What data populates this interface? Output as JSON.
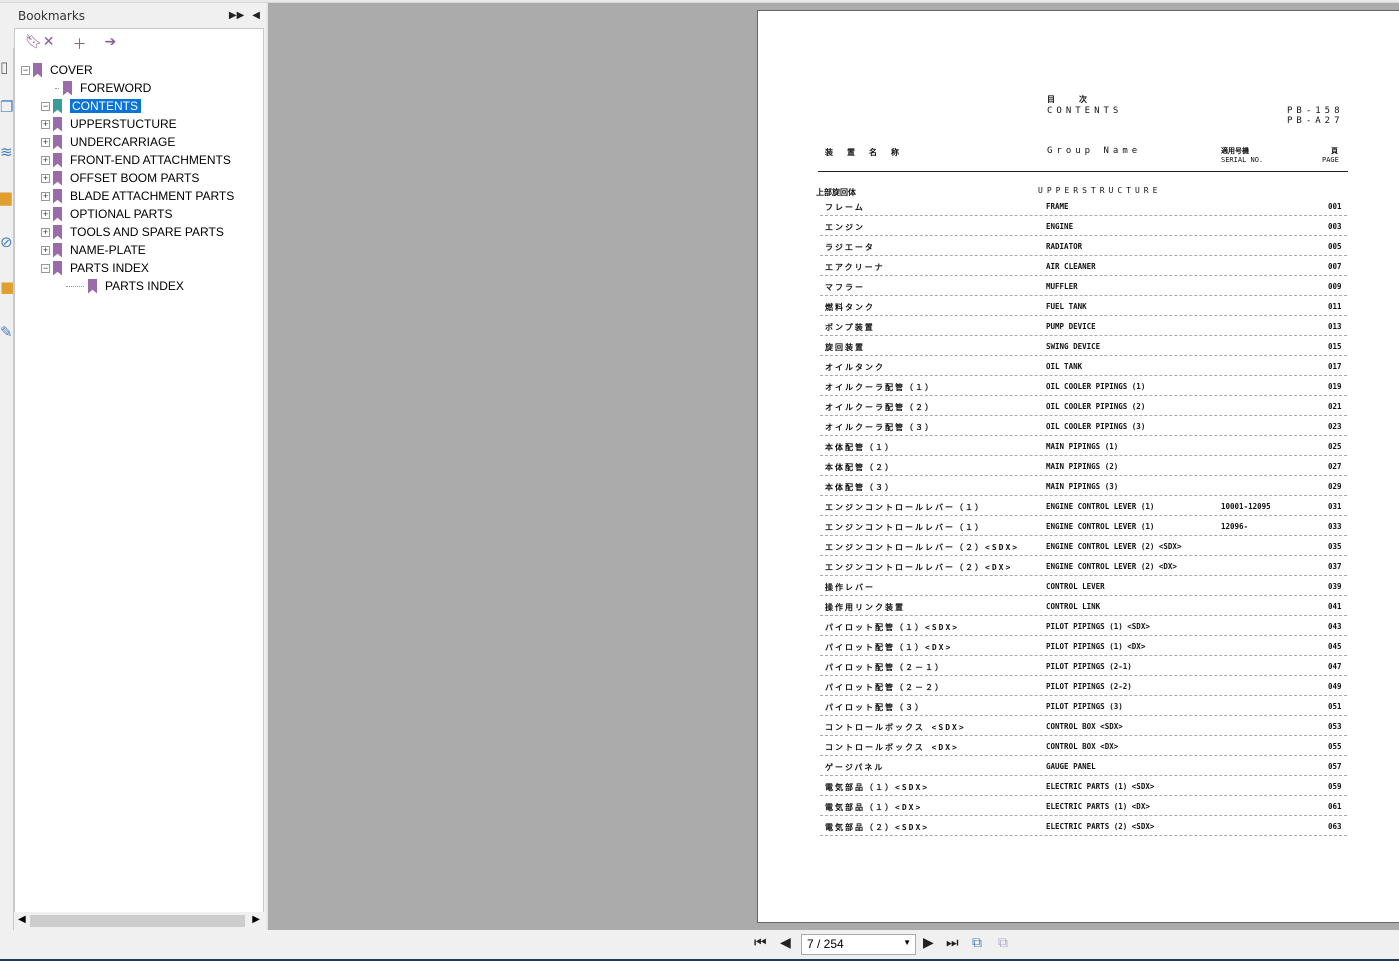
{
  "panel": {
    "title": "Bookmarks",
    "expand_icon": "double-arrow-icon",
    "collapse_icon": "triangle-left-icon",
    "toolbar": [
      "delete-bookmark-icon",
      "add-bookmark-icon",
      "go-to-bookmark-icon"
    ],
    "tree": [
      {
        "label": "COVER",
        "level": 0,
        "expander": "-"
      },
      {
        "label": "FOREWORD",
        "level": 1,
        "expander": ""
      },
      {
        "label": "CONTENTS",
        "level": 1,
        "expander": "-",
        "selected": true
      },
      {
        "label": "UPPERSTUCTURE",
        "level": 2,
        "expander": "+"
      },
      {
        "label": "UNDERCARRIAGE",
        "level": 2,
        "expander": "+"
      },
      {
        "label": "FRONT-END ATTACHMENTS",
        "level": 2,
        "expander": "+"
      },
      {
        "label": "OFFSET BOOM PARTS",
        "level": 2,
        "expander": "+"
      },
      {
        "label": "BLADE ATTACHMENT PARTS",
        "level": 2,
        "expander": "+"
      },
      {
        "label": "OPTIONAL PARTS",
        "level": 2,
        "expander": "+"
      },
      {
        "label": "TOOLS AND SPARE PARTS",
        "level": 2,
        "expander": "+"
      },
      {
        "label": "NAME-PLATE",
        "level": 2,
        "expander": "+"
      },
      {
        "label": "PARTS INDEX",
        "level": 2,
        "expander": "-"
      },
      {
        "label": "PARTS INDEX",
        "level": 3,
        "expander": ""
      }
    ]
  },
  "document": {
    "title_jp": "目　　　次",
    "title_en": "CONTENTS",
    "model1": "PB-158",
    "model2": "PB-A27",
    "col_jp": "装　置　名　称",
    "col_en": "Group Name",
    "col_serial_jp": "適用号機",
    "col_serial": "SERIAL NO.",
    "col_page_jp": "頁",
    "col_page": "PAGE",
    "section_jp": "上部旋回体",
    "section_en": "UPPERSTRUCTURE",
    "rows": [
      [
        "フレーム",
        "FRAME",
        "",
        "001"
      ],
      [
        "エンジン",
        "ENGINE",
        "",
        "003"
      ],
      [
        "ラジエータ",
        "RADIATOR",
        "",
        "005"
      ],
      [
        "エアクリーナ",
        "AIR CLEANER",
        "",
        "007"
      ],
      [
        "マフラー",
        "MUFFLER",
        "",
        "009"
      ],
      [
        "燃料タンク",
        "FUEL TANK",
        "",
        "011"
      ],
      [
        "ポンプ装置",
        "PUMP DEVICE",
        "",
        "013"
      ],
      [
        "旋回装置",
        "SWING DEVICE",
        "",
        "015"
      ],
      [
        "オイルタンク",
        "OIL TANK",
        "",
        "017"
      ],
      [
        "オイルクーラ配管（１）",
        "OIL COOLER PIPINGS (1)",
        "",
        "019"
      ],
      [
        "オイルクーラ配管（２）",
        "OIL COOLER PIPINGS (2)",
        "",
        "021"
      ],
      [
        "オイルクーラ配管（３）",
        "OIL COOLER PIPINGS (3)",
        "",
        "023"
      ],
      [
        "本体配管（１）",
        "MAIN PIPINGS (1)",
        "",
        "025"
      ],
      [
        "本体配管（２）",
        "MAIN PIPINGS (2)",
        "",
        "027"
      ],
      [
        "本体配管（３）",
        "MAIN PIPINGS (3)",
        "",
        "029"
      ],
      [
        "エンジンコントロールレバー（１）",
        "ENGINE CONTROL LEVER (1)",
        "10001-12095",
        "031"
      ],
      [
        "エンジンコントロールレバー（１）",
        "ENGINE CONTROL LEVER (1)",
        "12096-",
        "033"
      ],
      [
        "エンジンコントロールレバー（２）<SDX>",
        "ENGINE CONTROL LEVER (2) <SDX>",
        "",
        "035"
      ],
      [
        "エンジンコントロールレバー（２）<DX>",
        "ENGINE CONTROL LEVER (2) <DX>",
        "",
        "037"
      ],
      [
        "操作レバー",
        "CONTROL LEVER",
        "",
        "039"
      ],
      [
        "操作用リンク装置",
        "CONTROL LINK",
        "",
        "041"
      ],
      [
        "パイロット配管（１）<SDX>",
        "PILOT PIPINGS (1) <SDX>",
        "",
        "043"
      ],
      [
        "パイロット配管（１）<DX>",
        "PILOT PIPINGS (1) <DX>",
        "",
        "045"
      ],
      [
        "パイロット配管（２－１）",
        "PILOT PIPINGS (2-1)",
        "",
        "047"
      ],
      [
        "パイロット配管（２－２）",
        "PILOT PIPINGS (2-2)",
        "",
        "049"
      ],
      [
        "パイロット配管（３）",
        "PILOT PIPINGS (3)",
        "",
        "051"
      ],
      [
        "コントロールボックス <SDX>",
        "CONTROL BOX <SDX>",
        "",
        "053"
      ],
      [
        "コントロールボックス <DX>",
        "CONTROL BOX <DX>",
        "",
        "055"
      ],
      [
        "ゲージパネル",
        "GAUGE PANEL",
        "",
        "057"
      ],
      [
        "電気部品（１）<SDX>",
        "ELECTRIC PARTS (1) <SDX>",
        "",
        "059"
      ],
      [
        "電気部品（１）<DX>",
        "ELECTRIC PARTS (1) <DX>",
        "",
        "061"
      ],
      [
        "電気部品（２）<SDX>",
        "ELECTRIC PARTS (2) <SDX>",
        "",
        "063"
      ]
    ]
  },
  "nav": {
    "page_value": "7 / 254",
    "first": "⏮",
    "prev": "◀",
    "next": "▶",
    "last": "⏭"
  }
}
